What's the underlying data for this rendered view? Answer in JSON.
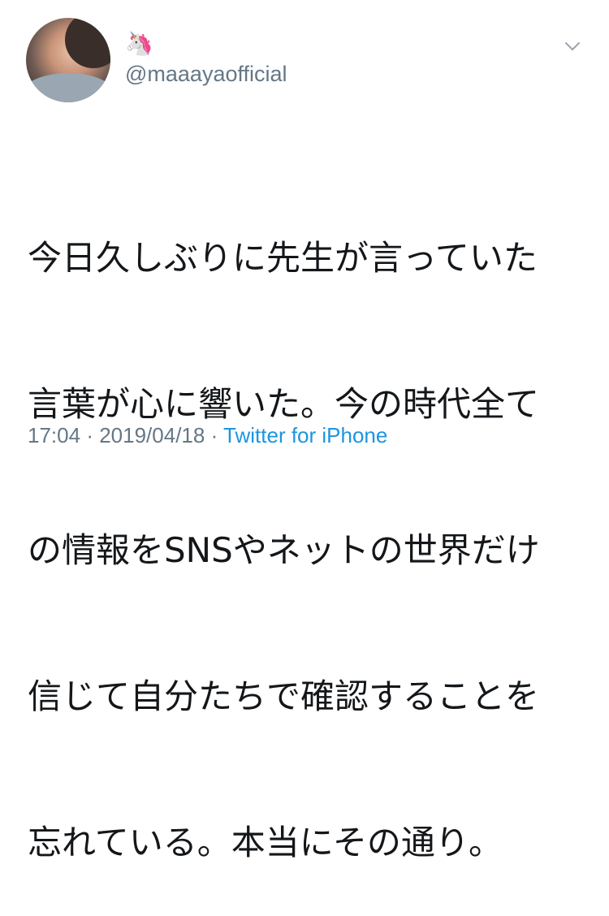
{
  "tweet": {
    "display_name_emoji": "🦄",
    "handle": "@maaayaofficial",
    "text_lines": [
      "今日久しぶりに先生が言っていた",
      "言葉が心に響いた。今の時代全て",
      "の情報をSNSやネットの世界だけ",
      "信じて自分たちで確認することを",
      "忘れている。本当にその通り。"
    ],
    "time": "17:04",
    "date": "2019/04/18",
    "separator": "·",
    "source": "Twitter for iPhone"
  },
  "colors": {
    "text": "#14171a",
    "secondary": "#657786",
    "link": "#1b95e0"
  },
  "icons": {
    "caret": "chevron-down-icon"
  }
}
